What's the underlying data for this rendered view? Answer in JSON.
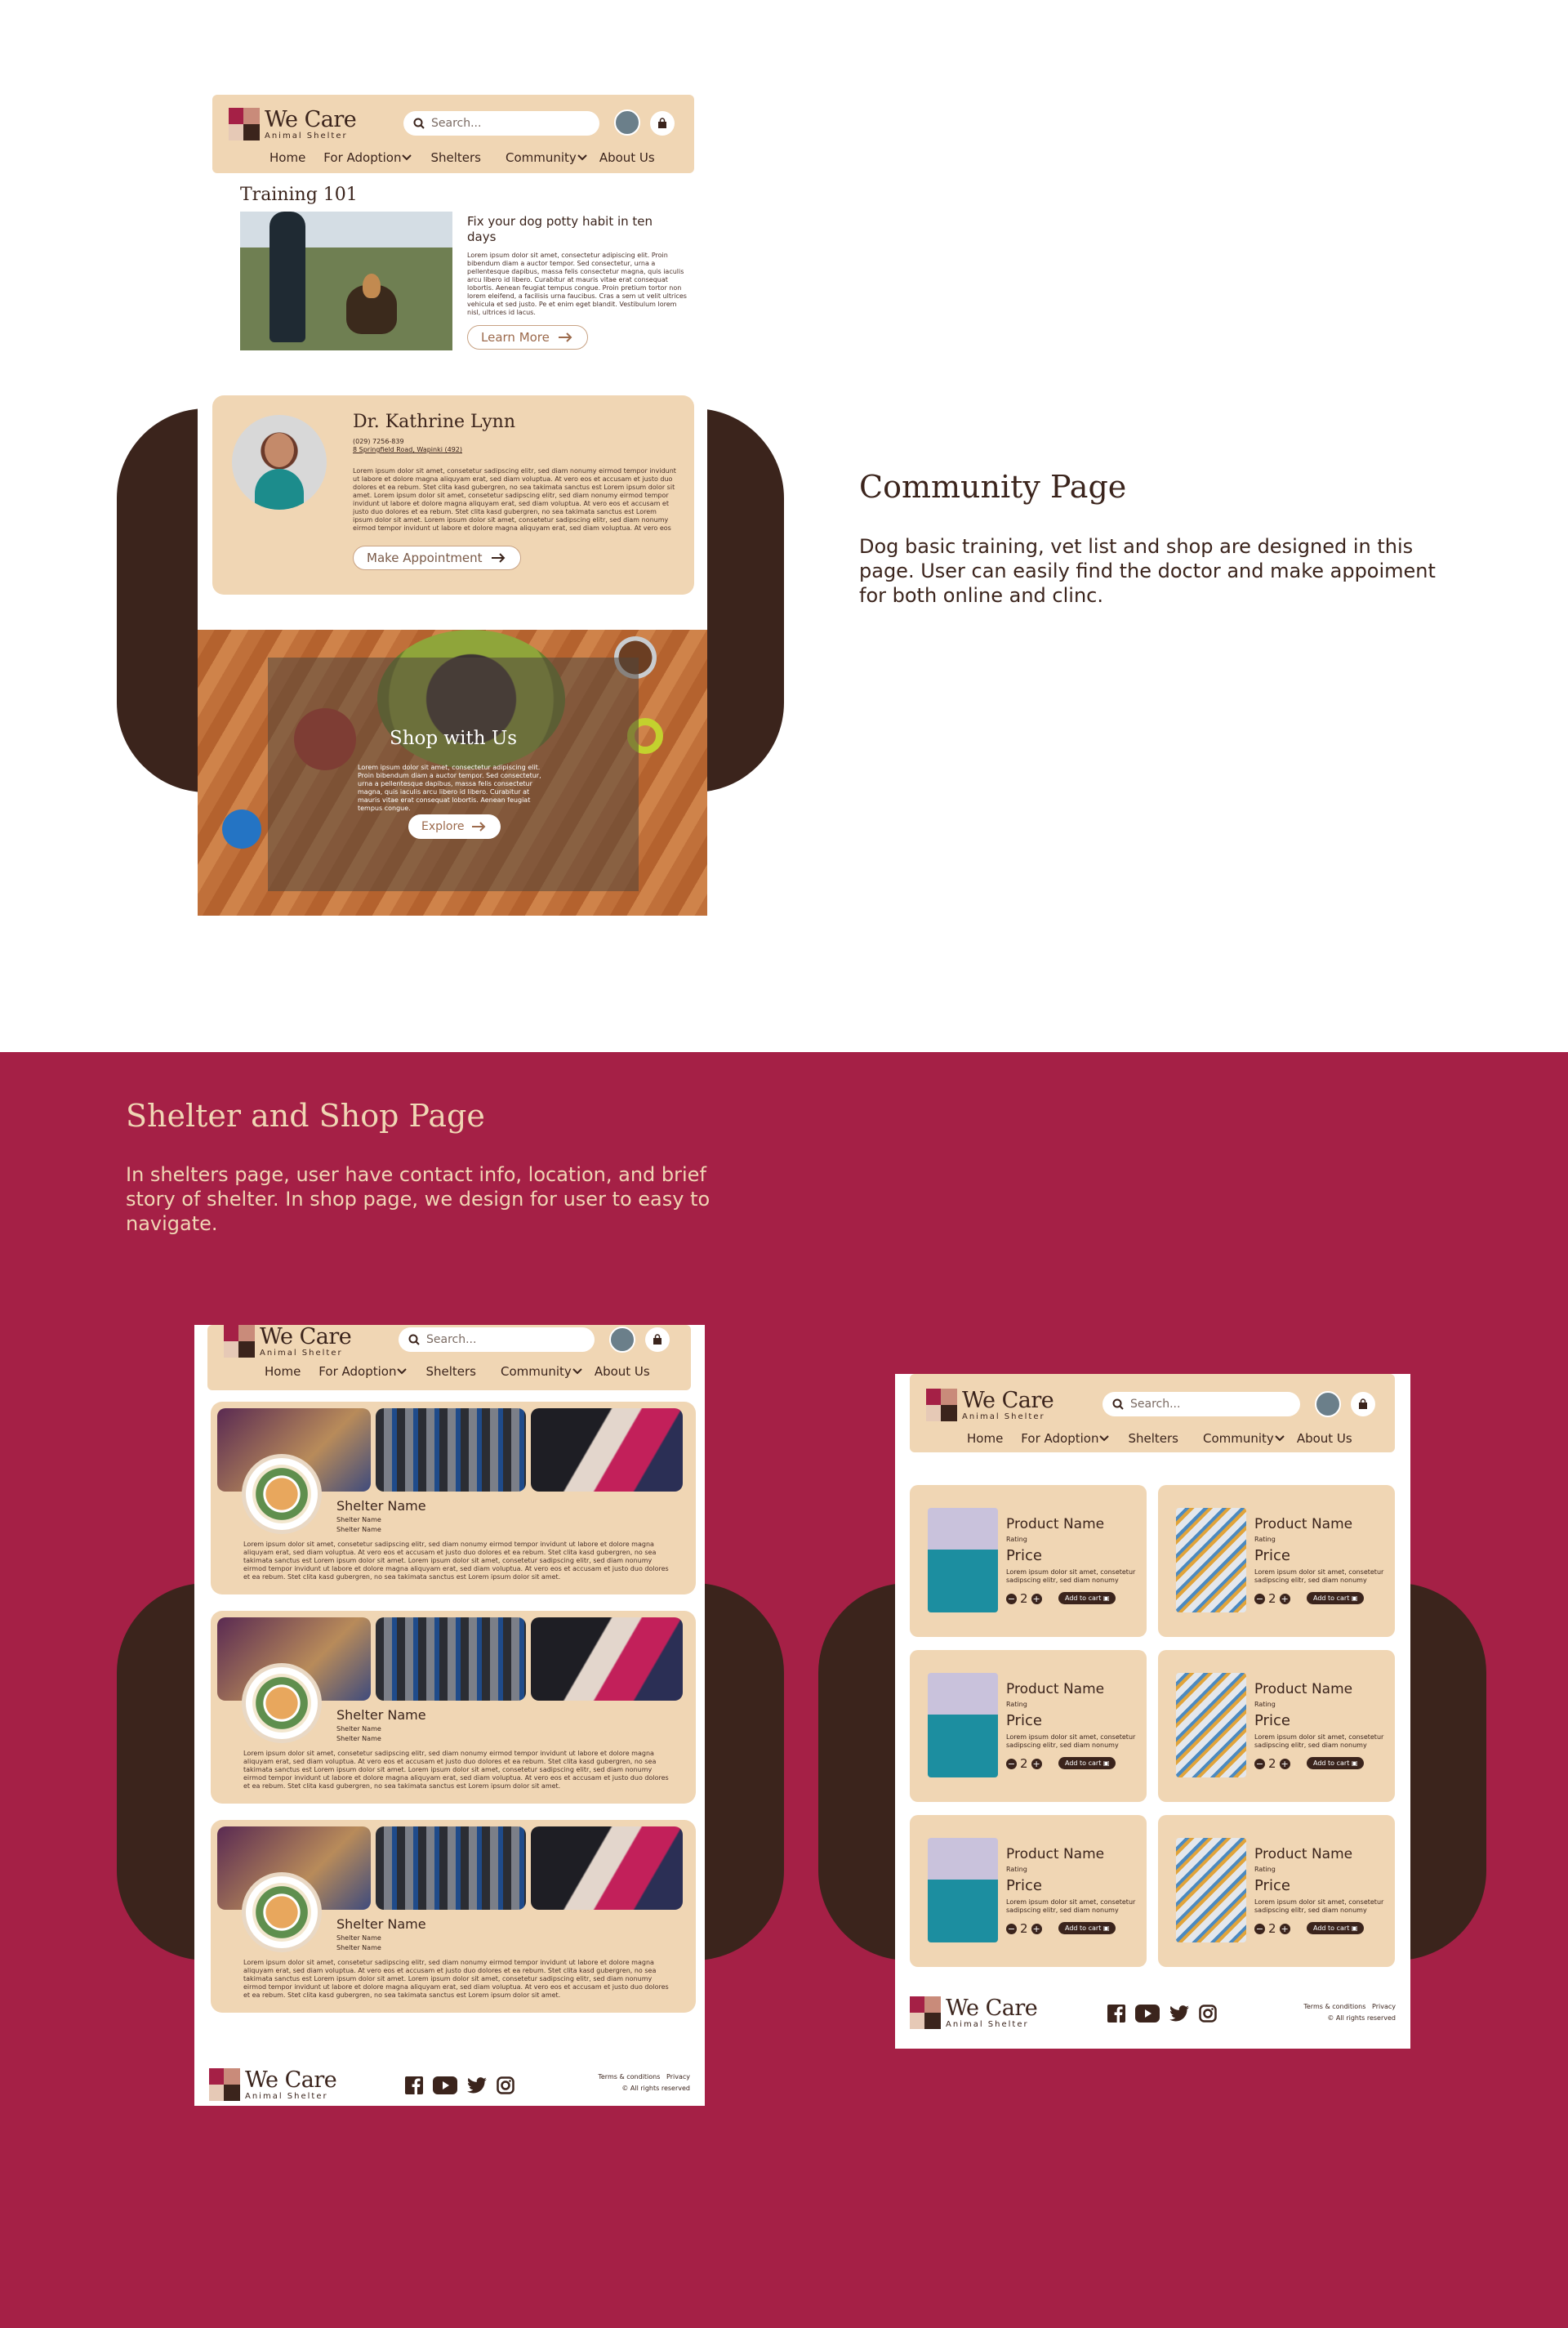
{
  "brand": {
    "name": "We Care",
    "tagline": "Animal Shelter"
  },
  "nav": {
    "search_placeholder": "Search...",
    "items": [
      "Home",
      "For Adoption",
      "Shelters",
      "Community",
      "About Us"
    ]
  },
  "community_page": {
    "title": "Community Page",
    "description": "Dog basic training, vet list and shop are designed in this page. User can easily find the doctor and make appoiment for both online and clinc.",
    "training": {
      "heading": "Training 101",
      "article_title": "Fix your dog potty habit in ten days",
      "article_body": "Lorem ipsum dolor sit amet, consectetur adipiscing elit. Proin bibendum diam a auctor tempor. Sed consectetur, urna a pellentesque dapibus, massa felis consectetur magna, quis iaculis arcu libero id libero. Curabitur at mauris vitae erat consequat lobortis. Aenean feugiat tempus congue. Proin pretium tortor non lorem eleifend, a facilisis urna faucibus. Cras a sem ut velit ultrices vehicula et sed justo. Pe et enim eget blandit. Vestibulum lorem nisl, ultrices id lacus.",
      "cta": "Learn More"
    },
    "vet": {
      "name": "Dr. Kathrine Lynn",
      "phone": "(029) 7256-839",
      "address": "8 Springfield Road, Wapinki (492)",
      "bio": "Lorem ipsum dolor sit amet, consetetur sadipscing elitr, sed diam nonumy eirmod tempor invidunt ut labore et dolore magna aliquyam erat, sed diam voluptua. At vero eos et accusam et justo duo dolores et ea rebum. Stet clita kasd gubergren, no sea takimata sanctus est Lorem ipsum dolor sit amet. Lorem ipsum dolor sit amet, consetetur sadipscing elitr, sed diam nonumy eirmod tempor invidunt ut labore et dolore magna aliquyam erat, sed diam voluptua. At vero eos et accusam et justo duo dolores et ea rebum. Stet clita kasd gubergren, no sea takimata sanctus est Lorem ipsum dolor sit amet. Lorem ipsum dolor sit amet, consetetur sadipscing elitr, sed diam nonumy eirmod tempor invidunt ut labore et dolore magna aliquyam erat, sed diam voluptua. At vero eos et accusam et justo duo dolores et",
      "cta": "Make Appointment"
    },
    "shop": {
      "title": "Shop with Us",
      "body": "Lorem ipsum dolor sit amet, consectetur adipiscing elit. Proin bibendum diam a auctor tempor. Sed consectetur, urna a pellentesque dapibus, massa felis consectetur magna, quis iaculis arcu libero id libero. Curabitur at mauris vitae erat consequat lobortis. Aenean feugiat tempus congue.",
      "cta": "Explore"
    }
  },
  "shelter_shop_page": {
    "title": "Shelter and Shop Page",
    "description": "In shelters page, user have contact info, location, and brief story of shelter. In shop page, we design for user to easy to navigate.",
    "shelter_card": {
      "name": "Shelter Name",
      "detail_1": "Shelter Name",
      "detail_2": "Shelter Name",
      "body": "Lorem ipsum dolor sit amet, consetetur sadipscing elitr, sed diam nonumy eirmod tempor invidunt ut labore et dolore magna aliquyam erat, sed diam voluptua. At vero eos et accusam et justo duo dolores et ea rebum. Stet clita kasd gubergren, no sea takimata sanctus est Lorem ipsum dolor sit amet. Lorem ipsum dolor sit amet, consetetur sadipscing elitr, sed diam nonumy eirmod tempor invidunt ut labore et dolore magna aliquyam erat, sed diam voluptua. At vero eos et accusam et justo duo dolores et ea rebum. Stet clita kasd gubergren, no sea takimata sanctus est Lorem ipsum dolor sit amet."
    },
    "product": {
      "name": "Product Name",
      "rating": "Rating",
      "price": "Price",
      "desc": "Lorem ipsum dolor sit amet, consetetur sadipscing elitr, sed diam nonumy",
      "qty": "2",
      "minus": "−",
      "plus": "+",
      "add_to_cart": "Add to cart"
    },
    "footer": {
      "terms": "Terms & conditions",
      "privacy": "Privacy",
      "rights": "All rights reserved"
    }
  },
  "colors": {
    "cream": "#f0d6b4",
    "brown": "#3b241c",
    "crimson": "#a52046"
  }
}
